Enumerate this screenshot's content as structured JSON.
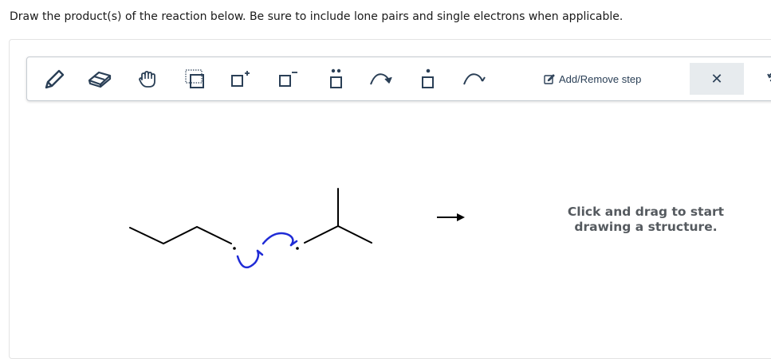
{
  "prompt": "Draw the product(s) of the reaction below. Be sure to include lone pairs and single electrons when applicable.",
  "toolbar": {
    "tools": [
      {
        "name": "pencil-icon"
      },
      {
        "name": "eraser-icon"
      },
      {
        "name": "hand-icon"
      },
      {
        "name": "select-icon"
      },
      {
        "name": "positive-charge-icon"
      },
      {
        "name": "negative-charge-icon"
      },
      {
        "name": "lone-pair-icon"
      },
      {
        "name": "curved-arrow-icon"
      },
      {
        "name": "single-electron-icon"
      },
      {
        "name": "fishhook-arrow-icon"
      }
    ],
    "add_remove_step": "Add/Remove step",
    "close_symbol": "✕"
  },
  "hint": {
    "line1": "Click and drag to start",
    "line2": "drawing a structure."
  },
  "colors": {
    "toolbar_icon": "#2a3f56",
    "mechanism_arrow": "#1f2bd6",
    "hint_text": "#555a5f"
  }
}
